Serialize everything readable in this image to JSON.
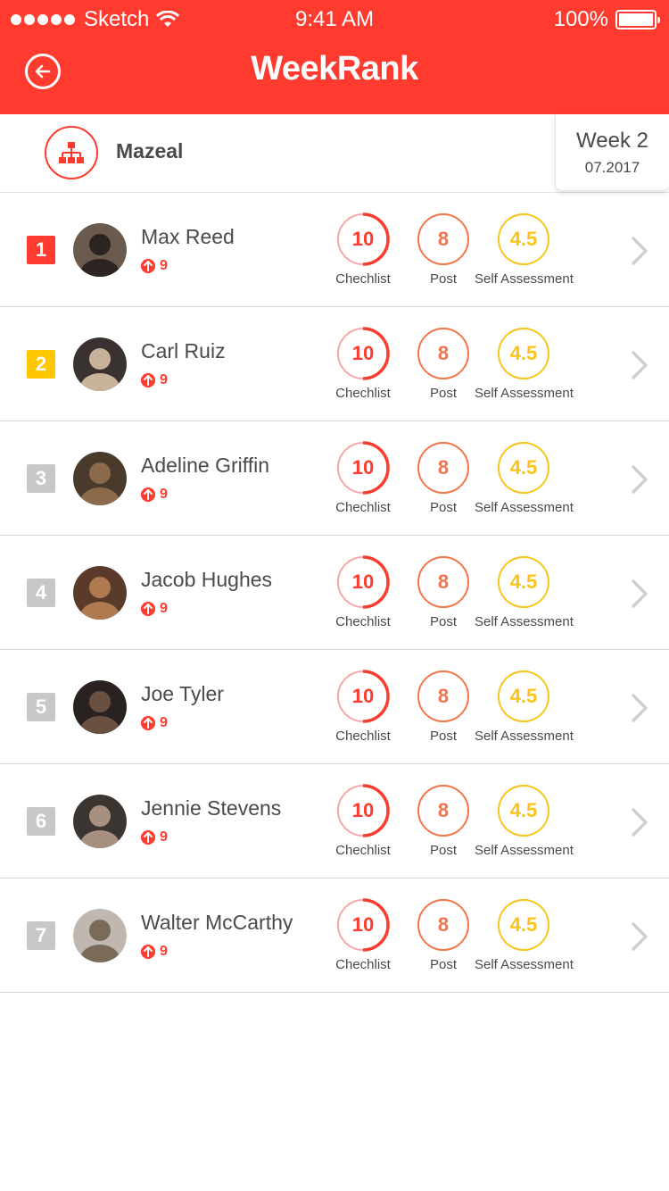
{
  "status_bar": {
    "carrier": "Sketch",
    "time": "9:41 AM",
    "battery": "100%"
  },
  "header": {
    "title": "WeekRank",
    "back_icon": "back-arrow-icon"
  },
  "subheader": {
    "org_icon": "org-chart-icon",
    "org_name": "Mazeal",
    "week_label": "Week 2",
    "week_date": "07.2017"
  },
  "colors": {
    "accent": "#ff3b30",
    "checklist": "#ff3b30",
    "post": "#f2744a",
    "self_assessment": "#f8c51c",
    "rank_top": "#ff3b30",
    "rank_second": "#ffc700",
    "rank_other": "#c8c8c8"
  },
  "labels": {
    "checklist": "Chechlist",
    "post": "Post",
    "self_assessment": "Self Assessment"
  },
  "rows": [
    {
      "rank": "1",
      "name": "Max Reed",
      "trend": "9",
      "checklist": "10",
      "post": "8",
      "self_assessment": "4.5"
    },
    {
      "rank": "2",
      "name": "Carl Ruiz",
      "trend": "9",
      "checklist": "10",
      "post": "8",
      "self_assessment": "4.5"
    },
    {
      "rank": "3",
      "name": "Adeline Griffin",
      "trend": "9",
      "checklist": "10",
      "post": "8",
      "self_assessment": "4.5"
    },
    {
      "rank": "4",
      "name": "Jacob Hughes",
      "trend": "9",
      "checklist": "10",
      "post": "8",
      "self_assessment": "4.5"
    },
    {
      "rank": "5",
      "name": "Joe Tyler",
      "trend": "9",
      "checklist": "10",
      "post": "8",
      "self_assessment": "4.5"
    },
    {
      "rank": "6",
      "name": "Jennie Stevens",
      "trend": "9",
      "checklist": "10",
      "post": "8",
      "self_assessment": "4.5"
    },
    {
      "rank": "7",
      "name": "Walter McCarthy",
      "trend": "9",
      "checklist": "10",
      "post": "8",
      "self_assessment": "4.5"
    }
  ]
}
